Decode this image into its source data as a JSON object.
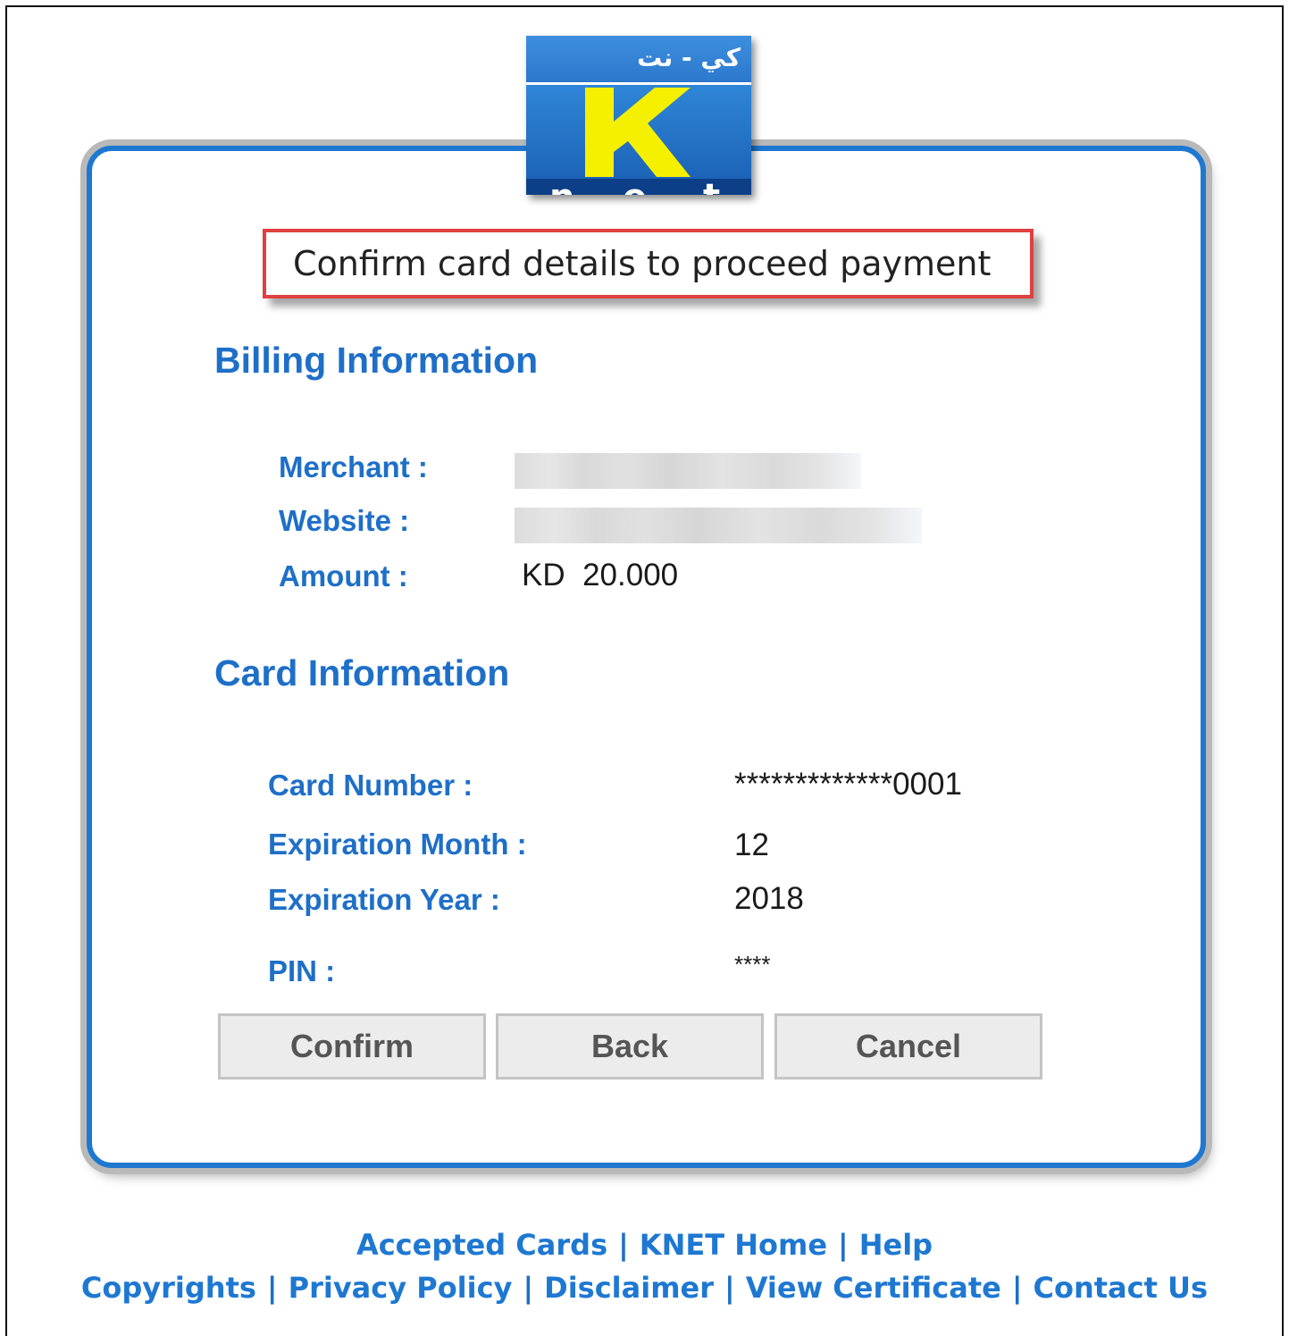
{
  "logo": {
    "arabic_text": "كي - نت",
    "letter": "K",
    "net_letters": [
      "n",
      "e",
      "t"
    ],
    "colors": {
      "blue": "#2b78cc",
      "yellow": "#f5f000"
    }
  },
  "prompt": "Confirm card details to proceed payment",
  "billing": {
    "heading": "Billing Information",
    "merchant_label": "Merchant :",
    "website_label": "Website :",
    "amount_label": "Amount :",
    "amount_value": "KD  20.000"
  },
  "card": {
    "heading": "Card Information",
    "number_label": "Card Number :",
    "number_value": "*************0001",
    "month_label": "Expiration Month :",
    "month_value": "12",
    "year_label": "Expiration Year :",
    "year_value": "2018",
    "pin_label": "PIN :",
    "pin_value": "****"
  },
  "buttons": {
    "confirm": "Confirm",
    "back": "Back",
    "cancel": "Cancel"
  },
  "footer": {
    "row1": [
      "Accepted Cards",
      "KNET Home",
      "Help"
    ],
    "row2": [
      "Copyrights",
      "Privacy Policy",
      "Disclaimer",
      "View Certificate",
      "Contact Us"
    ],
    "separator": "|"
  },
  "colors": {
    "accent": "#1e78d2",
    "highlight_border": "#e04040"
  }
}
